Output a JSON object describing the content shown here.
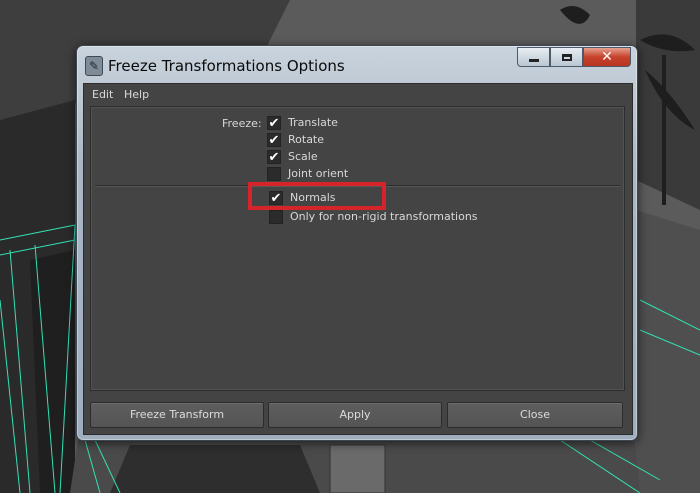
{
  "window": {
    "title": "Freeze Transformations Options",
    "close_glyph": "✕"
  },
  "menu": [
    {
      "label": "Edit"
    },
    {
      "label": "Help"
    }
  ],
  "options": {
    "freeze_label": "Freeze:",
    "checkboxes": [
      {
        "label": "Translate",
        "checked": true
      },
      {
        "label": "Rotate",
        "checked": true
      },
      {
        "label": "Scale",
        "checked": true
      },
      {
        "label": "Joint orient",
        "checked": false
      },
      {
        "label": "Normals",
        "checked": true
      },
      {
        "label": "Only for non-rigid transformations",
        "checked": false
      }
    ],
    "check_glyph": "✔"
  },
  "buttons": {
    "freeze_transform": "Freeze Transform",
    "apply": "Apply",
    "close": "Close"
  },
  "colors": {
    "highlight": "#d6242a",
    "panel_bg": "#444444",
    "close_button": "#c6422b"
  },
  "icons": {
    "app": "maya-app-icon",
    "minimize": "minimize-icon",
    "maximize": "maximize-icon",
    "close": "close-icon",
    "check": "checkmark-icon"
  }
}
